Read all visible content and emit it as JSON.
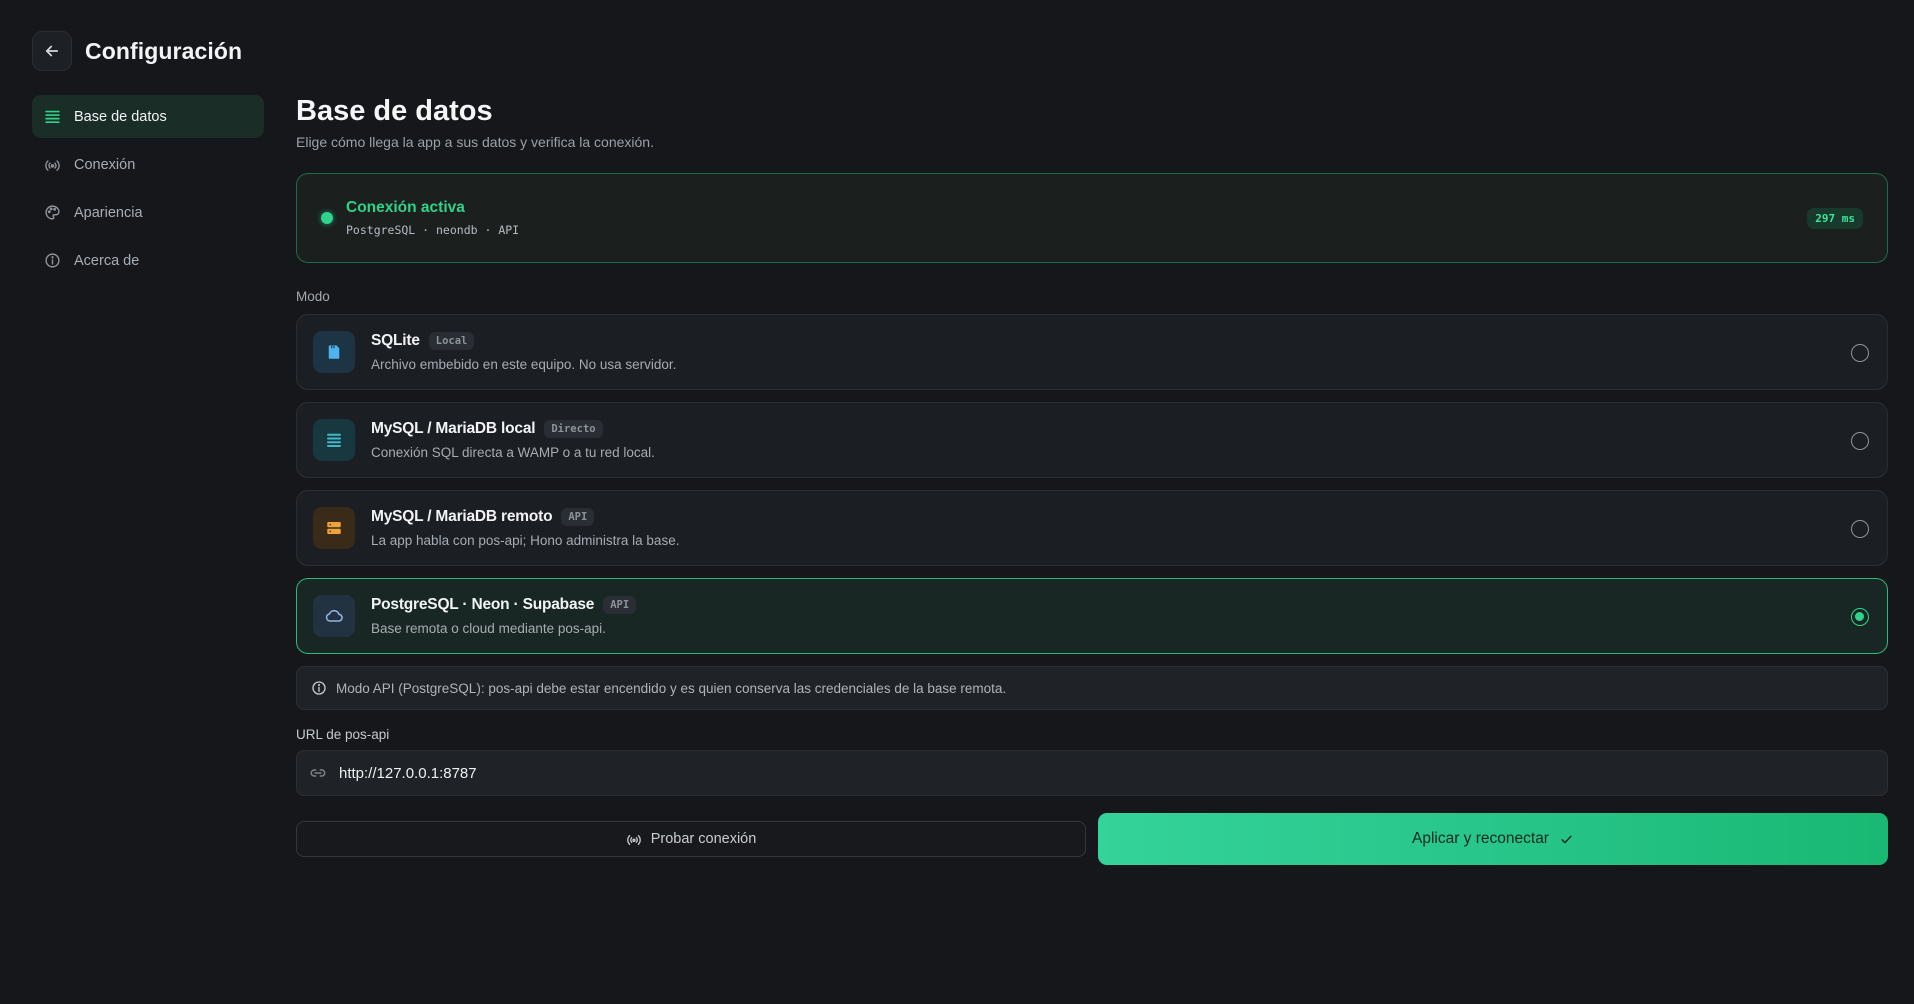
{
  "header": {
    "title": "Configuración",
    "back_icon": "arrow-left-icon"
  },
  "sidebar": {
    "items": [
      {
        "label": "Base de datos",
        "icon": "database-icon",
        "active": true
      },
      {
        "label": "Conexión",
        "icon": "signal-icon",
        "active": false
      },
      {
        "label": "Apariencia",
        "icon": "palette-icon",
        "active": false
      },
      {
        "label": "Acerca de",
        "icon": "info-icon",
        "active": false
      }
    ]
  },
  "main": {
    "title": "Base de datos",
    "subtitle": "Elige cómo llega la app a sus datos y verifica la conexión.",
    "status": {
      "title": "Conexión activa",
      "meta": "PostgreSQL · neondb · API",
      "latency": "297 ms",
      "color": "#2fd38b"
    },
    "mode_label": "Modo",
    "modes": [
      {
        "title": "SQLite",
        "tag": "Local",
        "desc": "Archivo embebido en este equipo. No usa servidor.",
        "icon": "file-icon",
        "icon_color": "#4fb3ee",
        "selected": false
      },
      {
        "title": "MySQL / MariaDB local",
        "tag": "Directo",
        "desc": "Conexión SQL directa a WAMP o a tu red local.",
        "icon": "list-icon",
        "icon_color": "#3fb8c9",
        "selected": false
      },
      {
        "title": "MySQL / MariaDB remoto",
        "tag": "API",
        "desc": "La app habla con pos-api; Hono administra la base.",
        "icon": "server-icon",
        "icon_color": "#f0a23a",
        "selected": false
      },
      {
        "title": "PostgreSQL · Neon · Supabase",
        "tag": "API",
        "desc": "Base remota o cloud mediante pos-api.",
        "icon": "cloud-icon",
        "icon_color": "#8fb4e8",
        "selected": true
      }
    ],
    "info": "Modo API (PostgreSQL): pos-api debe estar encendido y es quien conserva las credenciales de la base remota.",
    "url_label": "URL de pos-api",
    "url_value": "http://127.0.0.1:8787",
    "test_button": "Probar conexión",
    "apply_button": "Aplicar y reconectar",
    "accent": "#29c487"
  }
}
